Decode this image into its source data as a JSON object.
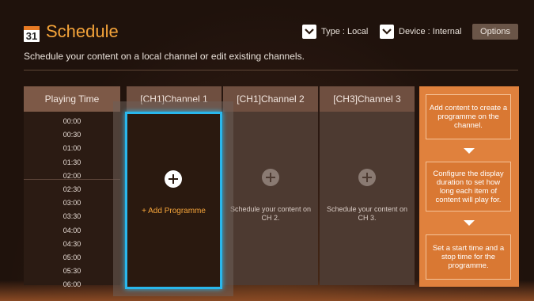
{
  "header": {
    "calendar_day": "31",
    "title": "Schedule",
    "subtitle": "Schedule your content on a local channel or edit existing channels.",
    "type_label": "Type : Local",
    "device_label": "Device : Internal",
    "options_label": "Options"
  },
  "grid": {
    "time_header": "Playing Time",
    "times": [
      "00:00",
      "00:30",
      "01:00",
      "01:30",
      "02:00",
      "02:30",
      "03:00",
      "03:30",
      "04:00",
      "04:30",
      "05:00",
      "05:30",
      "06:00"
    ],
    "channels": [
      {
        "label": "[CH1]Channel 1",
        "hint": "+ Add Programme"
      },
      {
        "label": "[CH1]Channel 2",
        "hint": "Schedule your content on CH 2."
      },
      {
        "label": "[CH3]Channel 3",
        "hint": "Schedule your content on CH 3."
      }
    ]
  },
  "guide": {
    "steps": [
      "Add content to create a programme on the channel.",
      "Configure the display duration to set how long each item of content will play for.",
      "Set a start time and a stop time for the programme."
    ]
  },
  "colors": {
    "accent": "#f5a43a",
    "focus": "#29b7ec",
    "guide_bg": "#e0813d"
  }
}
